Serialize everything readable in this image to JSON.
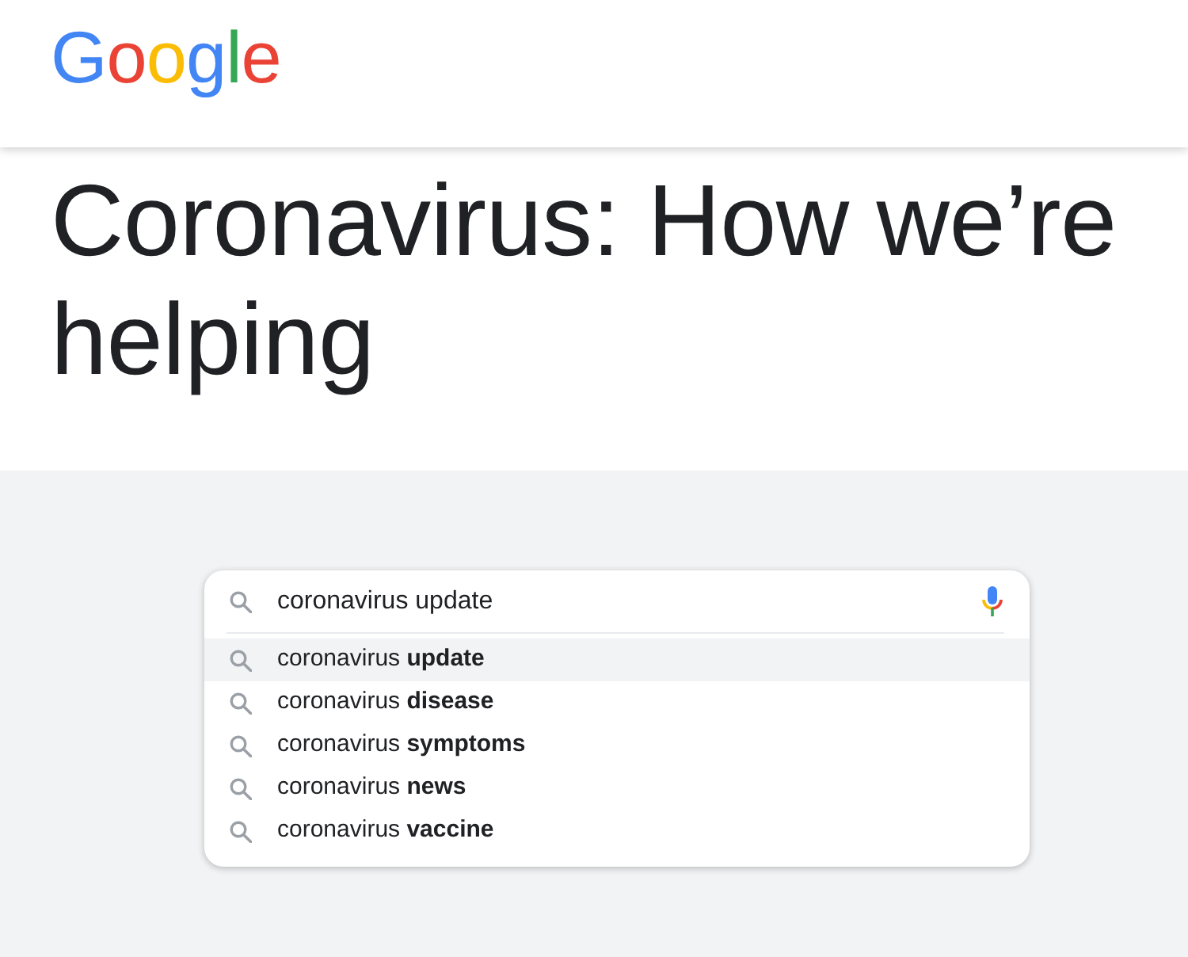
{
  "header": {
    "logo": "Google"
  },
  "heading": "Coronavirus: How we’re helping",
  "search": {
    "value": "coronavirus update",
    "suggestions": [
      {
        "text": "coronavirus **update**",
        "selected": true
      },
      {
        "text": "coronavirus **disease**",
        "selected": false
      },
      {
        "text": "coronavirus **symptoms**",
        "selected": false
      },
      {
        "text": "coronavirus **news**",
        "selected": false
      },
      {
        "text": "coronavirus **vaccine**",
        "selected": false
      }
    ]
  }
}
